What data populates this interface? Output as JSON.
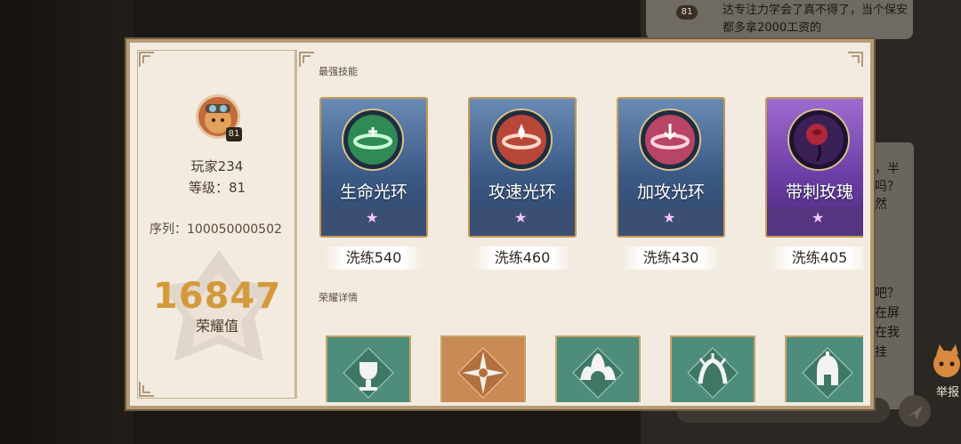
{
  "background": {
    "chat_top": "达专注力学会了真不得了，当个保安都多拿2000工资的",
    "chat_badge": "81",
    "side_lines_a": [
      "，半",
      "吗？",
      "然"
    ],
    "side_lines_b": [
      "吧？",
      "在屏",
      "在我",
      "挂"
    ],
    "input_hint": "发送",
    "report_label": "举报"
  },
  "profile": {
    "avatar_level": "81",
    "name": "玩家234",
    "level": "等级：81",
    "serial": "序列：100050000502",
    "honor_value": "16847",
    "honor_label": "荣耀值"
  },
  "skills_section": {
    "title": "最强技能",
    "items": [
      {
        "name": "生命光环",
        "refine": "洗练540",
        "icon": "life-aura-icon",
        "color": "#3fb36a"
      },
      {
        "name": "攻速光环",
        "refine": "洗练460",
        "icon": "attack-speed-aura-icon",
        "color": "#e06a4a"
      },
      {
        "name": "加攻光环",
        "refine": "洗练430",
        "icon": "attack-boost-aura-icon",
        "color": "#e05a78"
      },
      {
        "name": "带刺玫瑰",
        "refine": "洗练405",
        "icon": "thorn-rose-icon",
        "color": "#b0283a"
      }
    ]
  },
  "honor_section": {
    "title": "荣耀详情",
    "badges": [
      {
        "icon": "trophy-swords-icon",
        "style": "green"
      },
      {
        "icon": "compass-star-icon",
        "style": "orange"
      },
      {
        "icon": "flame-shield-icon",
        "style": "green"
      },
      {
        "icon": "claw-crest-icon",
        "style": "green"
      },
      {
        "icon": "spartan-helmet-icon",
        "style": "green"
      }
    ]
  }
}
